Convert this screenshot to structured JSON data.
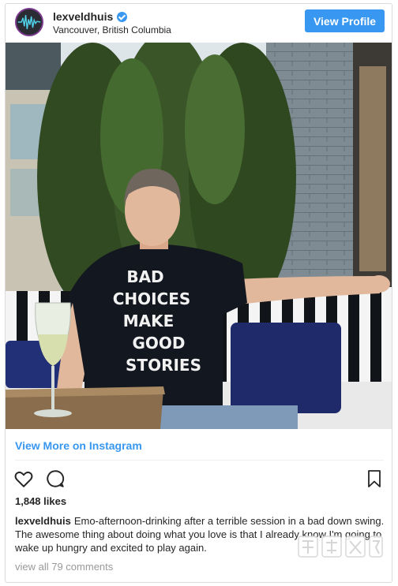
{
  "header": {
    "username": "lexveldhuis",
    "location": "Vancouver, British Columbia",
    "view_profile_label": "View Profile"
  },
  "photo": {
    "shirt_text": [
      "BAD",
      "CHOICES",
      "MAKE",
      "GOOD",
      "STORIES"
    ]
  },
  "footer": {
    "view_more_label": "View More on Instagram",
    "likes": "1,848 likes",
    "caption_user": "lexveldhuis",
    "caption_text": "Emo-afternoon-drinking after a terrible session in a bad down swing. The awesome thing about doing what you love is that I already know I'm going to wake up hungry and excited to play again.",
    "comments_link": "view all 79 comments"
  },
  "colors": {
    "accent": "#3897f0",
    "text": "#262626",
    "muted": "#999999"
  },
  "icons": [
    "verified-badge-icon",
    "heart-icon",
    "comment-icon",
    "bookmark-icon"
  ]
}
